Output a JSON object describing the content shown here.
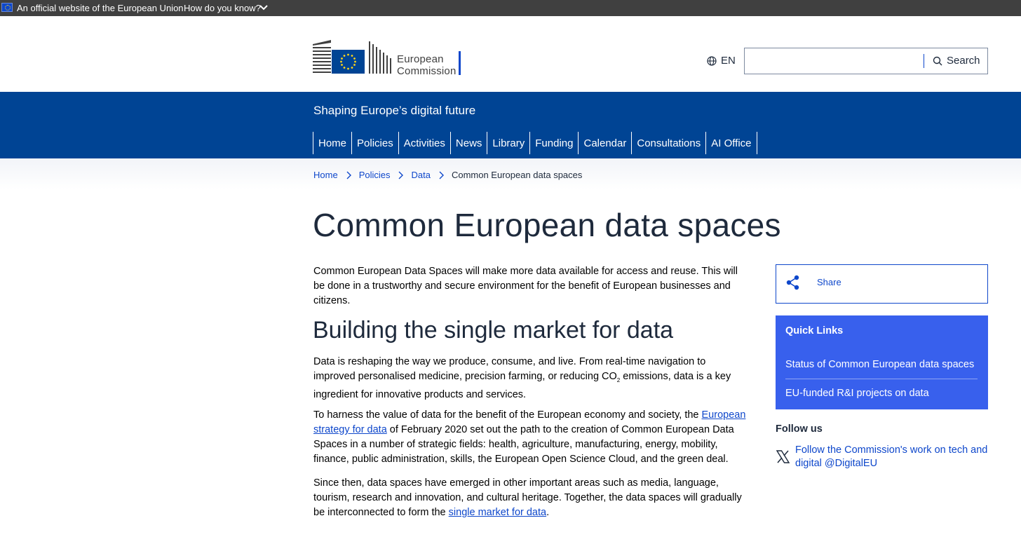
{
  "eu_bar": {
    "official": "An official website of the European Union",
    "how_know": "How do you know?"
  },
  "header": {
    "logo_line1": "European",
    "logo_line2": "Commission",
    "language": "EN",
    "search_placeholder": "",
    "search_label": "Search"
  },
  "site": {
    "name": "Shaping Europe’s digital future",
    "nav": [
      "Home",
      "Policies",
      "Activities",
      "News",
      "Library",
      "Funding",
      "Calendar",
      "Consultations",
      "AI Office"
    ]
  },
  "breadcrumb": {
    "items": [
      "Home",
      "Policies",
      "Data"
    ],
    "current": "Common European data spaces"
  },
  "main": {
    "title": "Common European data spaces",
    "intro": "Common European Data Spaces will make more data available for access and reuse. This will be done in a trustworthy and secure environment for the benefit of European businesses and citizens.",
    "h2": "Building the single market for data",
    "p1_a": "Data is reshaping the way we produce, consume, and live. From real-time navigation to improved personalised medicine, precision farming, or reducing CO",
    "p1_sub": "2",
    "p1_b": " emissions, data is a key ingredient for innovative products and services.",
    "p2_a": "To harness the value of data for the benefit of the European economy and society, the ",
    "p2_link": "European strategy for data",
    "p2_b": " of February 2020 set out the path to the creation of Common European Data Spaces in a number of strategic fields: health, agriculture, manufacturing, energy, mobility, finance, public administration, skills, the European Open Science Cloud, and the green deal.",
    "p3_a": "Since then, data spaces have emerged in other important areas such as media, language, tourism, research and innovation, and cultural heritage. Together, the data spaces will gradually be interconnected to form the ",
    "p3_link": "single market for data",
    "p3_b": "."
  },
  "sidebar": {
    "share": "Share",
    "quick_title": "Quick Links",
    "quick_links": [
      "Status of Common European data spaces",
      "EU-funded R&I projects on data"
    ],
    "follow_title": "Follow us",
    "follow_link": "Follow the Commission's work on tech and digital @DigitalEU"
  },
  "colors": {
    "eu_bar": "#404040",
    "site_band": "#004494",
    "link": "#0e47cb",
    "quick_links_bg": "#3860ed"
  },
  "icons": [
    "eu-flag-icon",
    "chevron-down-icon",
    "globe-icon",
    "search-icon",
    "chevron-right-icon",
    "share-icon",
    "x-logo-icon"
  ]
}
